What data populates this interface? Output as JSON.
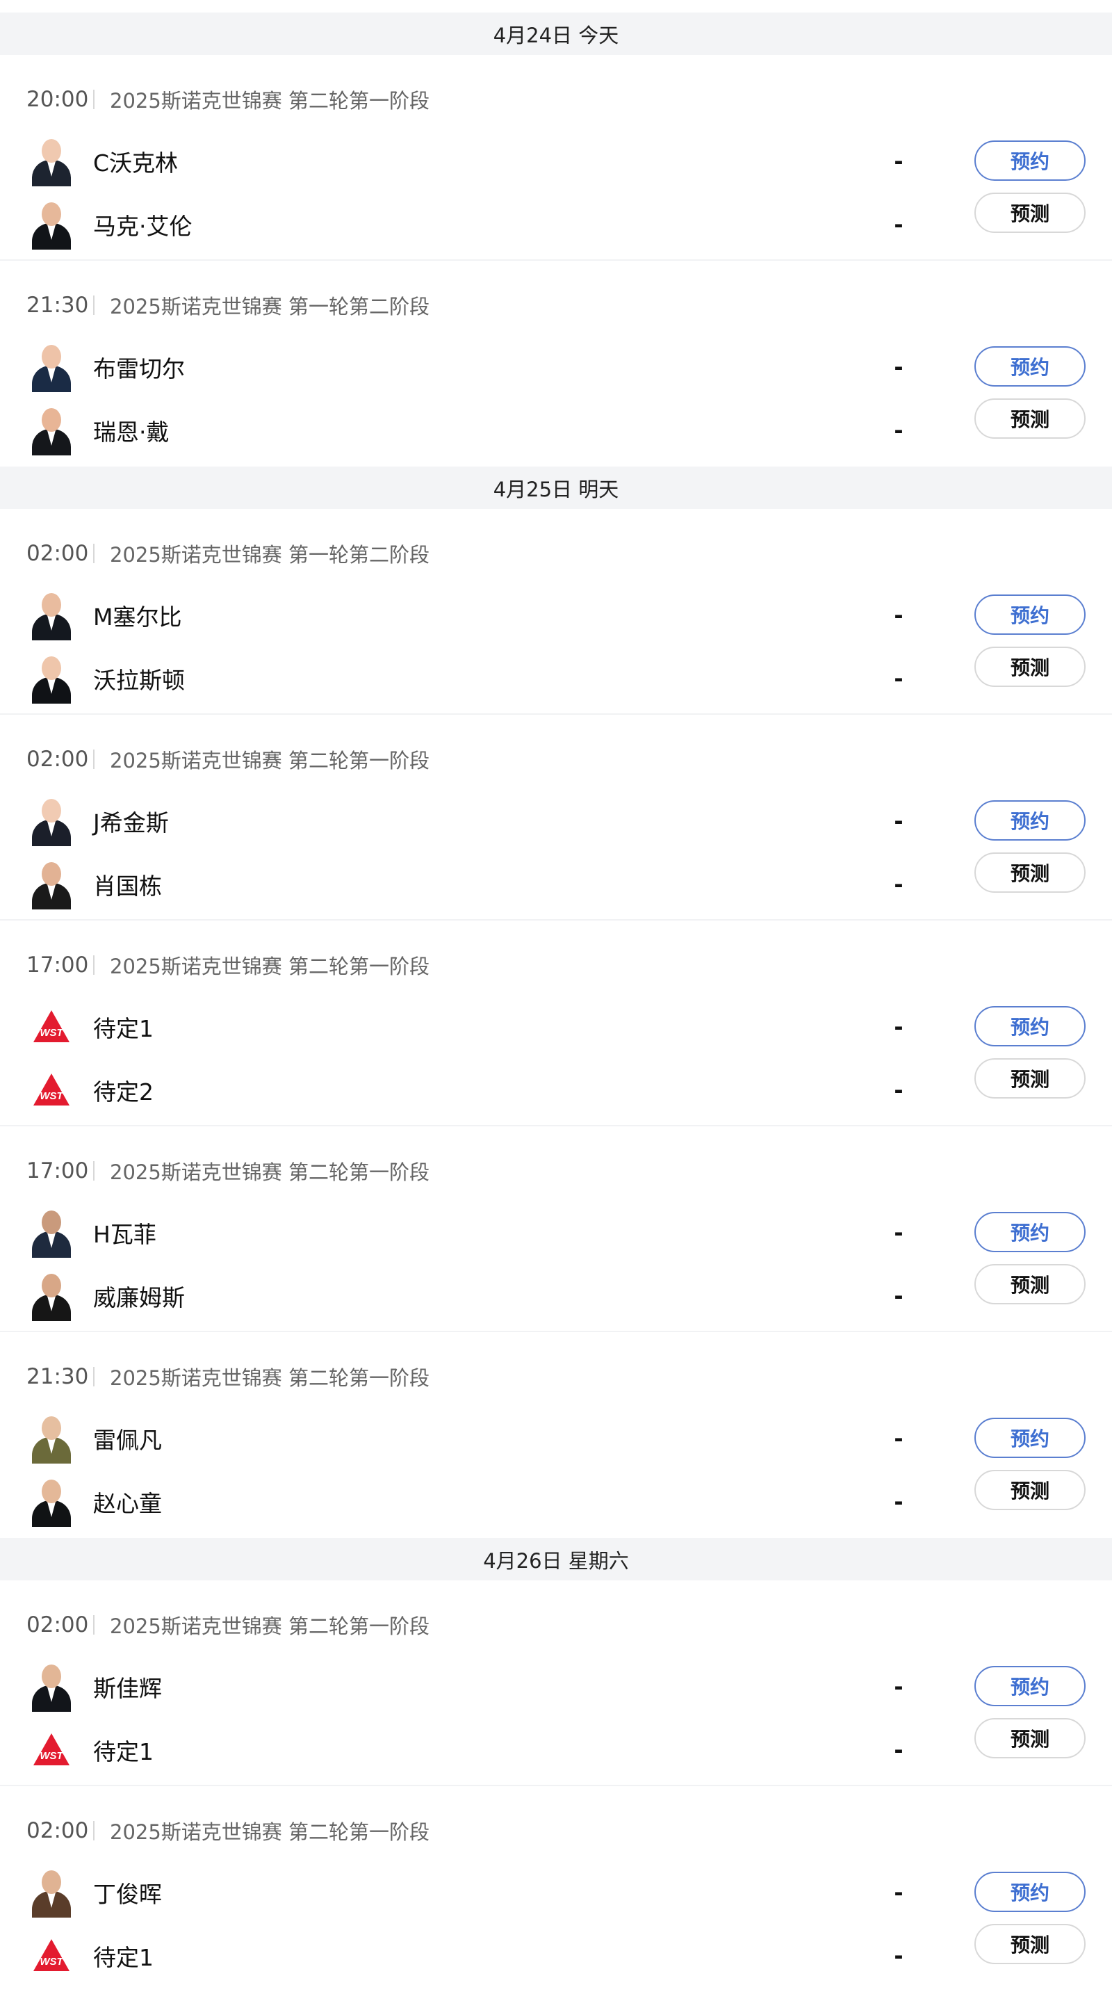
{
  "days": [
    {
      "header": "4月24日 今天",
      "matches": [
        {
          "time": "20:00",
          "event": "2025斯诺克世锦赛 第二轮第一阶段",
          "players": [
            {
              "name": "C沃克林",
              "score": "-",
              "avatar": "player-photo",
              "skin": "#f0c9b0",
              "suit": "#1d2430"
            },
            {
              "name": "马克·艾伦",
              "score": "-",
              "avatar": "player-photo",
              "skin": "#e6b89a",
              "suit": "#111418"
            }
          ],
          "reserve_label": "预约",
          "predict_label": "预测"
        },
        {
          "time": "21:30",
          "event": "2025斯诺克世锦赛 第一轮第二阶段",
          "players": [
            {
              "name": "布雷切尔",
              "score": "-",
              "avatar": "player-photo",
              "skin": "#eec3a8",
              "suit": "#1a2b45"
            },
            {
              "name": "瑞恩·戴",
              "score": "-",
              "avatar": "player-photo",
              "skin": "#e8b596",
              "suit": "#15171b"
            }
          ],
          "reserve_label": "预约",
          "predict_label": "预测"
        }
      ]
    },
    {
      "header": "4月25日 明天",
      "matches": [
        {
          "time": "02:00",
          "event": "2025斯诺克世锦赛 第一轮第二阶段",
          "players": [
            {
              "name": "M塞尔比",
              "score": "-",
              "avatar": "player-photo",
              "skin": "#e9bc9f",
              "suit": "#14181f"
            },
            {
              "name": "沃拉斯顿",
              "score": "-",
              "avatar": "player-photo",
              "skin": "#efc6ab",
              "suit": "#101216"
            }
          ],
          "reserve_label": "预约",
          "predict_label": "预测"
        },
        {
          "time": "02:00",
          "event": "2025斯诺克世锦赛 第二轮第一阶段",
          "players": [
            {
              "name": "J希金斯",
              "score": "-",
              "avatar": "player-photo",
              "skin": "#f1cbb3",
              "suit": "#1b1f2a"
            },
            {
              "name": "肖国栋",
              "score": "-",
              "avatar": "player-photo",
              "skin": "#e2b294",
              "suit": "#1a1a1a"
            }
          ],
          "reserve_label": "预约",
          "predict_label": "预测"
        },
        {
          "time": "17:00",
          "event": "2025斯诺克世锦赛 第二轮第一阶段",
          "players": [
            {
              "name": "待定1",
              "score": "-",
              "avatar": "wst-logo",
              "logo_text": "WST"
            },
            {
              "name": "待定2",
              "score": "-",
              "avatar": "wst-logo",
              "logo_text": "WST"
            }
          ],
          "reserve_label": "预约",
          "predict_label": "预测"
        },
        {
          "time": "17:00",
          "event": "2025斯诺克世锦赛 第二轮第一阶段",
          "players": [
            {
              "name": "H瓦菲",
              "score": "-",
              "avatar": "player-photo",
              "skin": "#c99a7c",
              "suit": "#1e2a3e"
            },
            {
              "name": "威廉姆斯",
              "score": "-",
              "avatar": "player-photo",
              "skin": "#d8a787",
              "suit": "#161616"
            }
          ],
          "reserve_label": "预约",
          "predict_label": "预测"
        },
        {
          "time": "21:30",
          "event": "2025斯诺克世锦赛 第二轮第一阶段",
          "players": [
            {
              "name": "雷佩凡",
              "score": "-",
              "avatar": "player-photo",
              "skin": "#e6bfa0",
              "suit": "#6b6a3a"
            },
            {
              "name": "赵心童",
              "score": "-",
              "avatar": "player-photo",
              "skin": "#e4b898",
              "suit": "#111315"
            }
          ],
          "reserve_label": "预约",
          "predict_label": "预测"
        }
      ]
    },
    {
      "header": "4月26日 星期六",
      "matches": [
        {
          "time": "02:00",
          "event": "2025斯诺克世锦赛 第二轮第一阶段",
          "players": [
            {
              "name": "斯佳辉",
              "score": "-",
              "avatar": "player-photo",
              "skin": "#e2b696",
              "suit": "#12151a"
            },
            {
              "name": "待定1",
              "score": "-",
              "avatar": "wst-logo",
              "logo_text": "WST"
            }
          ],
          "reserve_label": "预约",
          "predict_label": "预测"
        },
        {
          "time": "02:00",
          "event": "2025斯诺克世锦赛 第二轮第一阶段",
          "players": [
            {
              "name": "丁俊晖",
              "score": "-",
              "avatar": "player-photo",
              "skin": "#e0b393",
              "suit": "#5a3d2a"
            },
            {
              "name": "待定1",
              "score": "-",
              "avatar": "wst-logo",
              "logo_text": "WST"
            }
          ],
          "reserve_label": "预约",
          "predict_label": "预测"
        }
      ]
    }
  ],
  "colors": {
    "accent_blue": "#3e6fd1",
    "header_bg": "#f3f4f6",
    "wst_red": "#e31b2f"
  }
}
